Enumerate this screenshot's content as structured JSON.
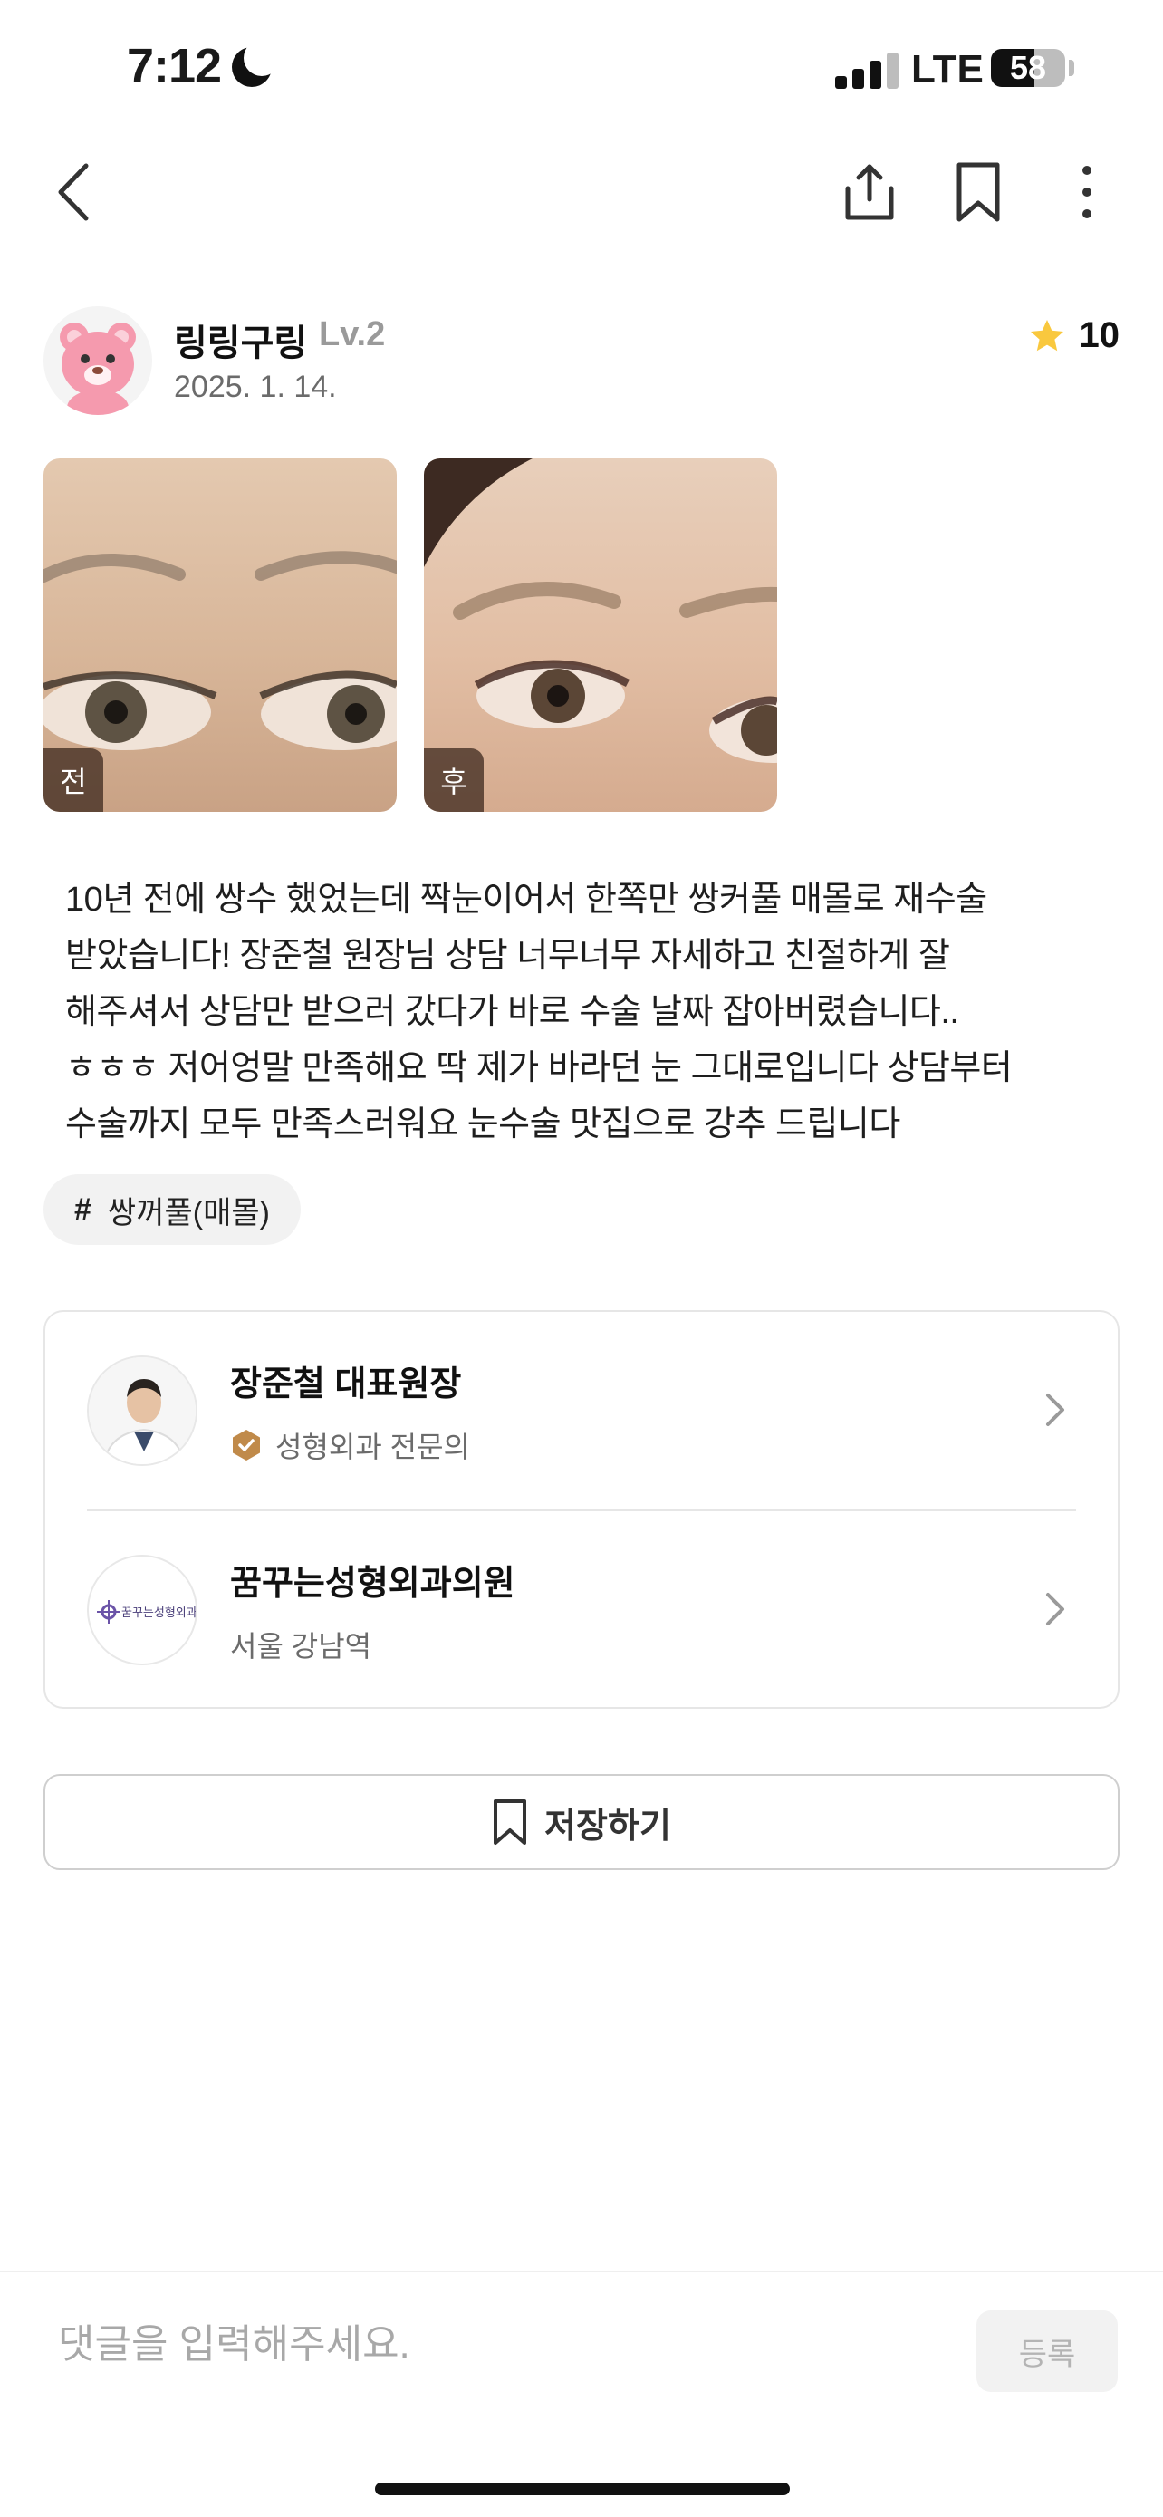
{
  "status_bar": {
    "time": "7:12",
    "network": "LTE",
    "battery": "58"
  },
  "author": {
    "name": "링링구링",
    "level": "Lv.2",
    "date": "2025. 1. 14."
  },
  "rating": {
    "value": "10",
    "star_color": "#F9C83E"
  },
  "photos": [
    {
      "tag": "전"
    },
    {
      "tag": "후"
    }
  ],
  "review": {
    "lines": [
      "10년 전에 쌍수 했었는데 짝눈이어서 한쪽만 쌍커풀 매몰로 재수술",
      "받았습니다! 장준철 원장님 상담 너무너무 자세하고 친절하게 잘",
      "해주셔서 상담만 받으러 갔다가 바로 수술 날짜 잡아버렸습니다..",
      "ㅎㅎㅎ 저어엉말 만족해요 딱 제가 바라던 눈 그대로입니다 상담부터",
      "수술까지 모두 만족스러워요 눈수술 맛집으로 강추 드립니다"
    ]
  },
  "hashtag": {
    "symbol": "#",
    "label": "쌍꺼풀(매몰)"
  },
  "doctor": {
    "name": "장준철 대표원장",
    "specialty": "성형외과 전문의",
    "badge_color": "#C08A4A"
  },
  "clinic": {
    "name": "꿈꾸는성형외과의원",
    "location": "서울 강남역",
    "logo_text": "꿈꾸는성형외과"
  },
  "save_button": {
    "label": "저장하기"
  },
  "comment": {
    "placeholder": "댓글을 입력해주세요.",
    "submit_label": "등록"
  }
}
